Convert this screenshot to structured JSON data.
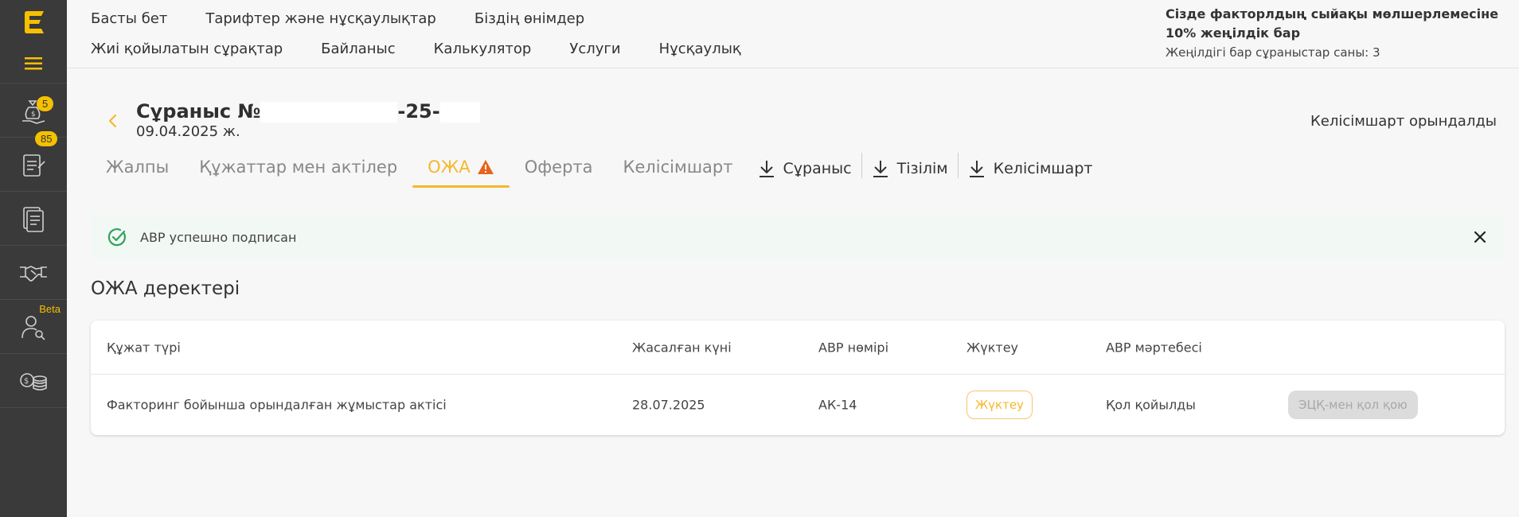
{
  "sidebar": {
    "badges": {
      "funds": "5",
      "requests": "85"
    },
    "beta_label": "Beta"
  },
  "topnav": [
    "Басты бет",
    "Тарифтер және нұсқаулықтар",
    "Біздің өнімдер",
    "Жиі қойылатын сұрақтар",
    "Байланыс",
    "Калькулятор",
    "Услуги",
    "Нұсқаулық"
  ],
  "promo": {
    "text": "Сізде факторлдың сыйақы мөлшерлемесіне 10% жеңілдік бар",
    "count": "Жеңілдігі бар сұраныстар саны: 3"
  },
  "request": {
    "title_prefix": "Сұраныс №",
    "title_mid": "-25-",
    "date": "09.04.2025 ж.",
    "status": "Келісімшарт орындалды"
  },
  "tabs": [
    "Жалпы",
    "Құжаттар мен актілер",
    "ОЖА",
    "Оферта",
    "Келісімшарт"
  ],
  "downloads": [
    "Сұраныс",
    "Тізілім",
    "Келісімшарт"
  ],
  "alert": {
    "text": "АВР успешно подписан"
  },
  "section_title": "ОЖА деректері",
  "table": {
    "headers": [
      "Құжат түрі",
      "Жасалған күні",
      "АВР нөмірі",
      "Жүктеу",
      "АВР мәртебесі"
    ],
    "rows": [
      {
        "doc_type": "Факторинг бойынша орындалған жұмыстар актісі",
        "date": "28.07.2025",
        "number": "АК-14",
        "download": "Жүктеу",
        "status": "Қол қойылды",
        "sign": "ЭЦҚ-мен қол қою"
      }
    ]
  },
  "colors": {
    "accent": "#f5b82e",
    "sidebar": "#3a3a3a",
    "success": "#2fa35a"
  }
}
